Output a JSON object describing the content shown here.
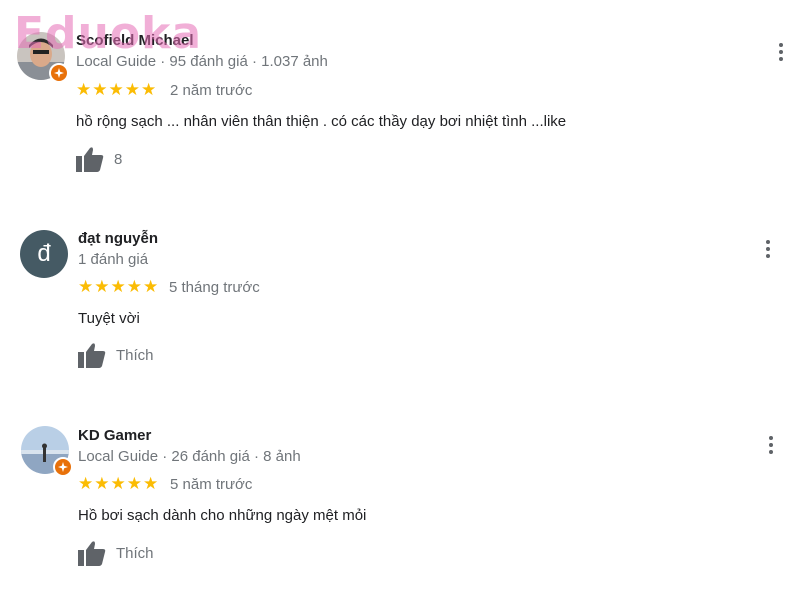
{
  "watermark": "Eduoka",
  "reviews": [
    {
      "author": "Scofield Michael",
      "meta": "Local Guide · 95 đánh giá · 1.037 ảnh",
      "stars": "★★★★★",
      "rating": 5,
      "time": "2 năm trước",
      "text": "hồ rộng sạch ... nhân viên thân thiện . có các thầy dạy bơi nhiệt tình ...like",
      "like_label": "8"
    },
    {
      "author": "đạt nguyễn",
      "avatar_letter": "đ",
      "meta": "1 đánh giá",
      "stars": "★★★★★",
      "rating": 5,
      "time": "5 tháng trước",
      "text": "Tuyệt vời",
      "like_label": "Thích"
    },
    {
      "author": "KD Gamer",
      "meta": "Local Guide · 26 đánh giá · 8 ảnh",
      "stars": "★★★★★",
      "rating": 5,
      "time": "5 năm trước",
      "text": "Hồ bơi sạch dành cho những ngày mệt mỏi",
      "like_label": "Thích"
    }
  ],
  "colors": {
    "star": "#fbbc04",
    "guide_badge": "#e8710a",
    "secondary_text": "#70757a"
  }
}
